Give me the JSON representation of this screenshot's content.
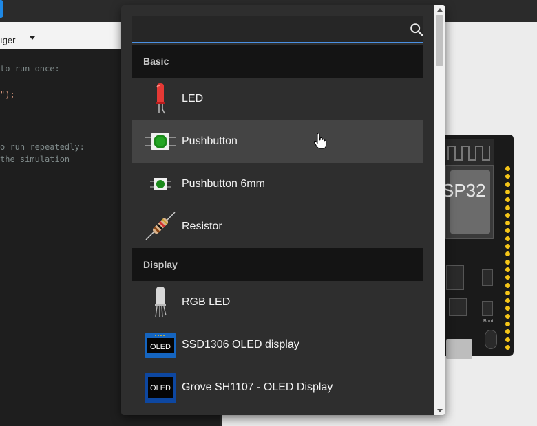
{
  "app": {
    "toolbar_label": "ıger",
    "editor_lines": [
      {
        "text": "to run once:",
        "kind": "comment"
      },
      {
        "text": "\");",
        "kind": "code"
      },
      {
        "text": "o run repeatedly:",
        "kind": "comment"
      },
      {
        "text": "the simulation",
        "kind": "comment"
      }
    ],
    "board_label": "SP32",
    "boot_label": "Boot"
  },
  "search": {
    "placeholder": "",
    "value": ""
  },
  "sections": [
    {
      "title": "Basic",
      "items": [
        {
          "label": "LED",
          "icon": "red-led-icon"
        },
        {
          "label": "Pushbutton",
          "icon": "pushbutton-icon",
          "hovered": true
        },
        {
          "label": "Pushbutton 6mm",
          "icon": "pushbutton-6mm-icon"
        },
        {
          "label": "Resistor",
          "icon": "resistor-icon"
        }
      ]
    },
    {
      "title": "Display",
      "items": [
        {
          "label": "RGB LED",
          "icon": "rgb-led-icon"
        },
        {
          "label": "SSD1306 OLED display",
          "icon": "ssd1306-oled-icon",
          "icon_text": "OLED"
        },
        {
          "label": "Grove SH1107 - OLED Display",
          "icon": "grove-oled-icon",
          "icon_text": "OLED"
        }
      ]
    }
  ],
  "colors": {
    "accent": "#4a90e2",
    "popup_bg": "#2e2e2e",
    "section_bg": "#141414",
    "hover_bg": "#444444",
    "pin": "#f5c518"
  }
}
